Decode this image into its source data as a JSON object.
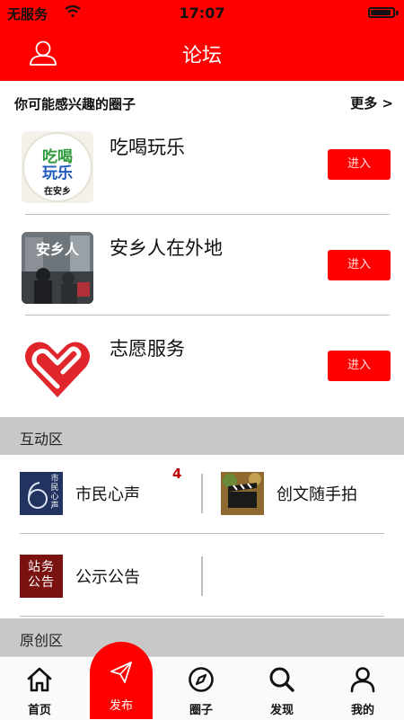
{
  "status_bar": {
    "carrier": "无服务",
    "time": "17:07"
  },
  "nav": {
    "title": "论坛"
  },
  "circles_section": {
    "title": "你可能感兴趣的圈子",
    "more_label": "更多 >",
    "items": [
      {
        "name": "吃喝玩乐",
        "thumb_text": [
          "吃喝",
          "玩乐",
          "在安乡"
        ],
        "enter_label": "进入"
      },
      {
        "name": "安乡人在外地",
        "thumb_text": [
          "安乡人"
        ],
        "enter_label": "进入"
      },
      {
        "name": "志愿服务",
        "enter_label": "进入"
      }
    ]
  },
  "interaction_section": {
    "title": "互动区",
    "items": [
      {
        "label": "市民心声",
        "icon_text": "市民心声",
        "badge": "4"
      },
      {
        "label": "创文随手拍",
        "icon": "film-clapper"
      },
      {
        "label": "公示公告",
        "icon_text": "站务公告"
      }
    ]
  },
  "original_section": {
    "title": "原创区"
  },
  "tab_bar": {
    "items": [
      {
        "label": "首页",
        "icon": "home-icon"
      },
      {
        "label": "发布",
        "icon": "paper-plane-icon",
        "active": true
      },
      {
        "label": "圈子",
        "icon": "compass-icon"
      },
      {
        "label": "发现",
        "icon": "search-icon"
      },
      {
        "label": "我的",
        "icon": "person-icon"
      }
    ]
  },
  "colors": {
    "brand_red": "#ff0000",
    "badge_red": "#c00000",
    "section_grey": "#c8c8c8"
  }
}
